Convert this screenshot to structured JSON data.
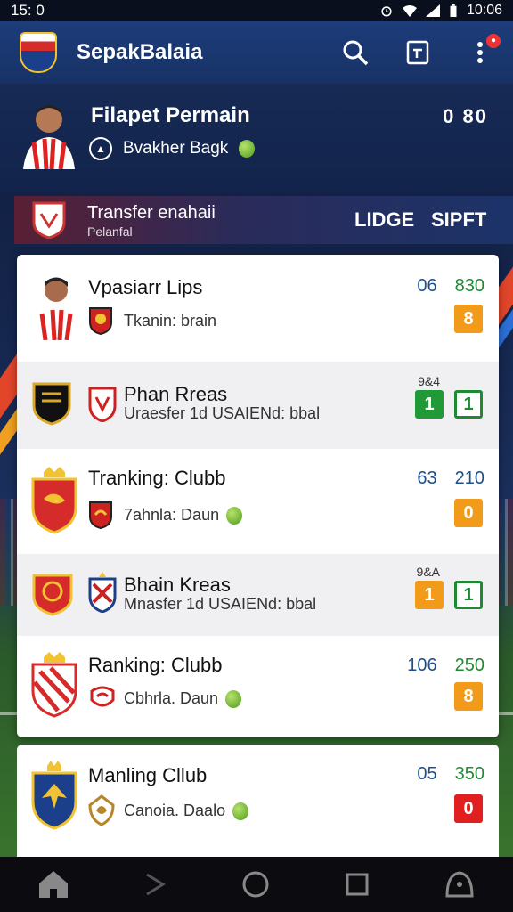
{
  "status_bar": {
    "left_text": "15: 0",
    "time": "10:06"
  },
  "app_bar": {
    "title": "SepakBalaia",
    "icons": [
      "search-icon",
      "calendar-icon",
      "more-vert-icon"
    ]
  },
  "featured": {
    "name": "Filapet Permain",
    "sub_label": "Bvakher Bagk",
    "score": "0 80"
  },
  "banner": {
    "title": "Transfer enahaii",
    "subtitle": "Pelanfal",
    "button1": "LIDGE",
    "button2": "SIPFT"
  },
  "rows": [
    {
      "title": "Vpasiarr Lips",
      "sub": "Tkanin: brain",
      "num1": "06",
      "num2": "830",
      "box1": "8"
    },
    {
      "title": "Phan Rreas",
      "sub": "Uraesfer 1d USAIENd: bbal",
      "top_num": "9&4",
      "box1": "1",
      "box2": "1"
    },
    {
      "title": "Tranking: Clubb",
      "sub": "7ahnla: Daun",
      "num1": "63",
      "num2": "210",
      "box1": "0"
    },
    {
      "title": "Bhain Kreas",
      "sub": "Mnasfer 1d USAIENd: bbal",
      "top_num": "9&A",
      "box1": "1",
      "box2": "1"
    },
    {
      "title": "Ranking: Clubb",
      "sub": "Cbhrla. Daun",
      "num1": "106",
      "num2": "250",
      "box1": "8"
    }
  ],
  "last_card": {
    "title": "Manling Cllub",
    "sub": "Canoia. Daalo",
    "num1": "05",
    "num2": "350",
    "box1": "0"
  },
  "colors": {
    "app_bar": "#1d3c7a",
    "orange": "#f29a1a",
    "green": "#1f9a36",
    "red": "#e02020",
    "blue_num": "#1b4f8f"
  }
}
